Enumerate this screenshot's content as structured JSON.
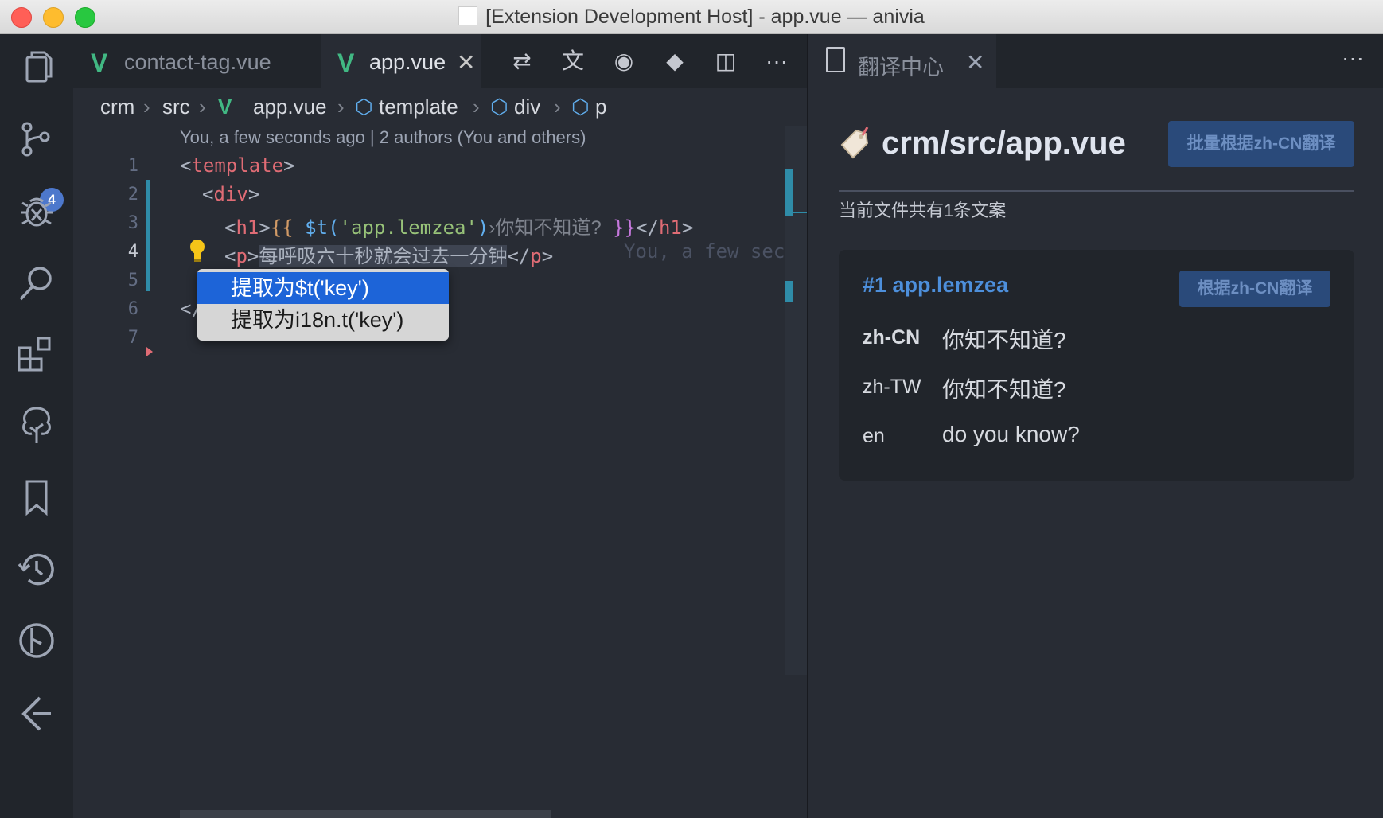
{
  "window": {
    "title": "[Extension Development Host] - app.vue — anivia"
  },
  "activity_bar": {
    "items": [
      {
        "name": "explorer",
        "icon": "files-icon"
      },
      {
        "name": "source-control",
        "icon": "source-control-icon",
        "badge": "4"
      },
      {
        "name": "debug",
        "icon": "bug-icon"
      },
      {
        "name": "search",
        "icon": "search-icon"
      },
      {
        "name": "extensions",
        "icon": "extensions-icon"
      },
      {
        "name": "tree",
        "icon": "tree-icon"
      },
      {
        "name": "bookmarks",
        "icon": "bookmark-icon"
      },
      {
        "name": "history",
        "icon": "history-icon"
      },
      {
        "name": "git-graph",
        "icon": "git-graph-icon"
      },
      {
        "name": "gitlens",
        "icon": "gitlens-icon"
      }
    ]
  },
  "editor_tabs": [
    {
      "label": "contact-tag.vue",
      "active": false
    },
    {
      "label": "app.vue",
      "active": true
    }
  ],
  "editor_toolbar": [
    "compare-icon",
    "translate-icon",
    "eye-icon",
    "git-icon",
    "split-icon",
    "more-icon"
  ],
  "breadcrumb": [
    "crm",
    "src",
    "app.vue",
    "template",
    "div",
    "p"
  ],
  "blame": "You, a few seconds ago | 2 authors (You and others)",
  "code": {
    "line_numbers": [
      "1",
      "2",
      "3",
      "4",
      "5",
      "6",
      "7"
    ],
    "l1": {
      "open": "<",
      "tag": "template",
      "close": ">"
    },
    "l2": {
      "open": "<",
      "tag": "div",
      "close": ">"
    },
    "l3": {
      "o1": "<",
      "tag": "h1",
      "c1": ">",
      "brace_open": "{{",
      "fn": "$t",
      "paren_open": "(",
      "str": "'app.lemzea'",
      "paren_close": ")",
      "hint": "›你知不知道?",
      "brace_close": "}}",
      "o2": "</",
      "tag2": "h1",
      "c2": ">"
    },
    "l4": {
      "o1": "<",
      "tag": "p",
      "c1": ">",
      "text": "每呼吸六十秒就会过去一分钟",
      "o2": "</",
      "tag2": "p",
      "c2": ">",
      "blame_inline": "You, a few secon"
    },
    "l6": {
      "text": "</"
    }
  },
  "context_menu": {
    "items": [
      {
        "label": "提取为$t('key')",
        "selected": true
      },
      {
        "label": "提取为i18n.t('key')",
        "selected": false
      }
    ]
  },
  "right_tab": {
    "label": "翻译中心"
  },
  "translation_panel": {
    "file_path": "crm/src/app.vue",
    "batch_button": "批量根据zh-CN翻译",
    "summary": "当前文件共有1条文案",
    "entry": {
      "key": "#1 app.lemzea",
      "translate_button": "根据zh-CN翻译",
      "rows": [
        {
          "lang": "zh-CN",
          "value": "你知不知道?"
        },
        {
          "lang": "zh-TW",
          "value": "你知不知道?"
        },
        {
          "lang": "en",
          "value": "do you know?"
        }
      ]
    }
  },
  "colors": {
    "accent": "#4d78cc",
    "vue": "#41b883",
    "selection": "#1d64d8"
  }
}
